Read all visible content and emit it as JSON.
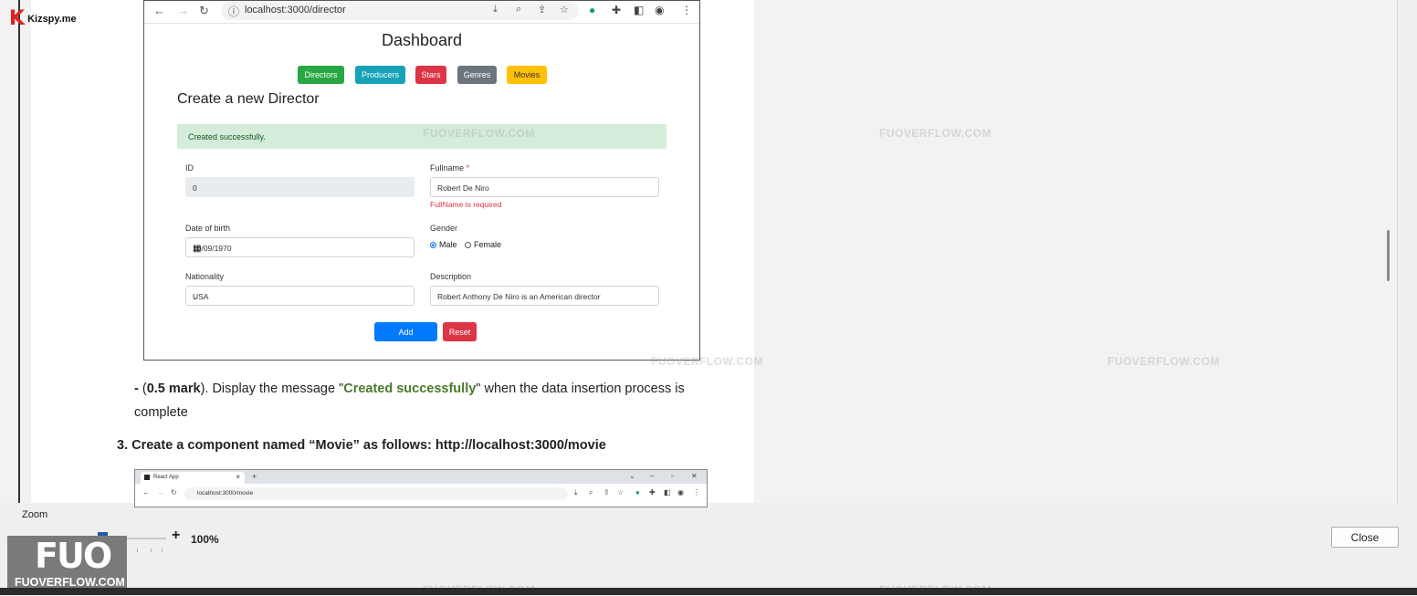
{
  "branding": {
    "kizspy": "Kizspy.me",
    "fuo_big": "FUO",
    "fuo_small": "FUOVERFLOW.COM",
    "watermark": "FUOVERFLOW.COM"
  },
  "browser": {
    "url": "localhost:3000/director"
  },
  "app": {
    "title": "Dashboard",
    "nav": [
      {
        "label": "Directors",
        "color": "#28a745"
      },
      {
        "label": "Producers",
        "color": "#17a2b8"
      },
      {
        "label": "Stars",
        "color": "#dc3545"
      },
      {
        "label": "Genres",
        "color": "#6c757d"
      },
      {
        "label": "Movies",
        "color": "#ffc107"
      }
    ],
    "form_title": "Create a new Director",
    "alert": "Created successfully.",
    "fields": {
      "id_label": "ID",
      "id_value": "0",
      "fullname_label": "Fullname",
      "fullname_required": "*",
      "fullname_value": "Robert De Niro",
      "fullname_error": "FullName is required",
      "dob_label": "Date of birth",
      "dob_value": "10/09/1970",
      "gender_label": "Gender",
      "gender_male": "Male",
      "gender_female": "Female",
      "nationality_label": "Nationality",
      "nationality_value": "USA",
      "description_label": "Description",
      "description_value": "Robert Anthony De Niro is an American director"
    },
    "add": "Add",
    "reset": "Reset"
  },
  "doc": {
    "bullet": "- ",
    "mark": "0.5 mark",
    "text1": "). Display the message \"",
    "highlight": "Created successfully",
    "text2": "\" when the data insertion process is complete",
    "step": "3. Create a component named “Movie” as follows: http://localhost:3000/movie"
  },
  "browser2": {
    "tab": "React App",
    "url": "localhost:3000/movie"
  },
  "zoom": {
    "label": "Zoom",
    "minus": "-",
    "plus": "+",
    "value": "100%",
    "level_percent": 100
  },
  "close": "Close"
}
